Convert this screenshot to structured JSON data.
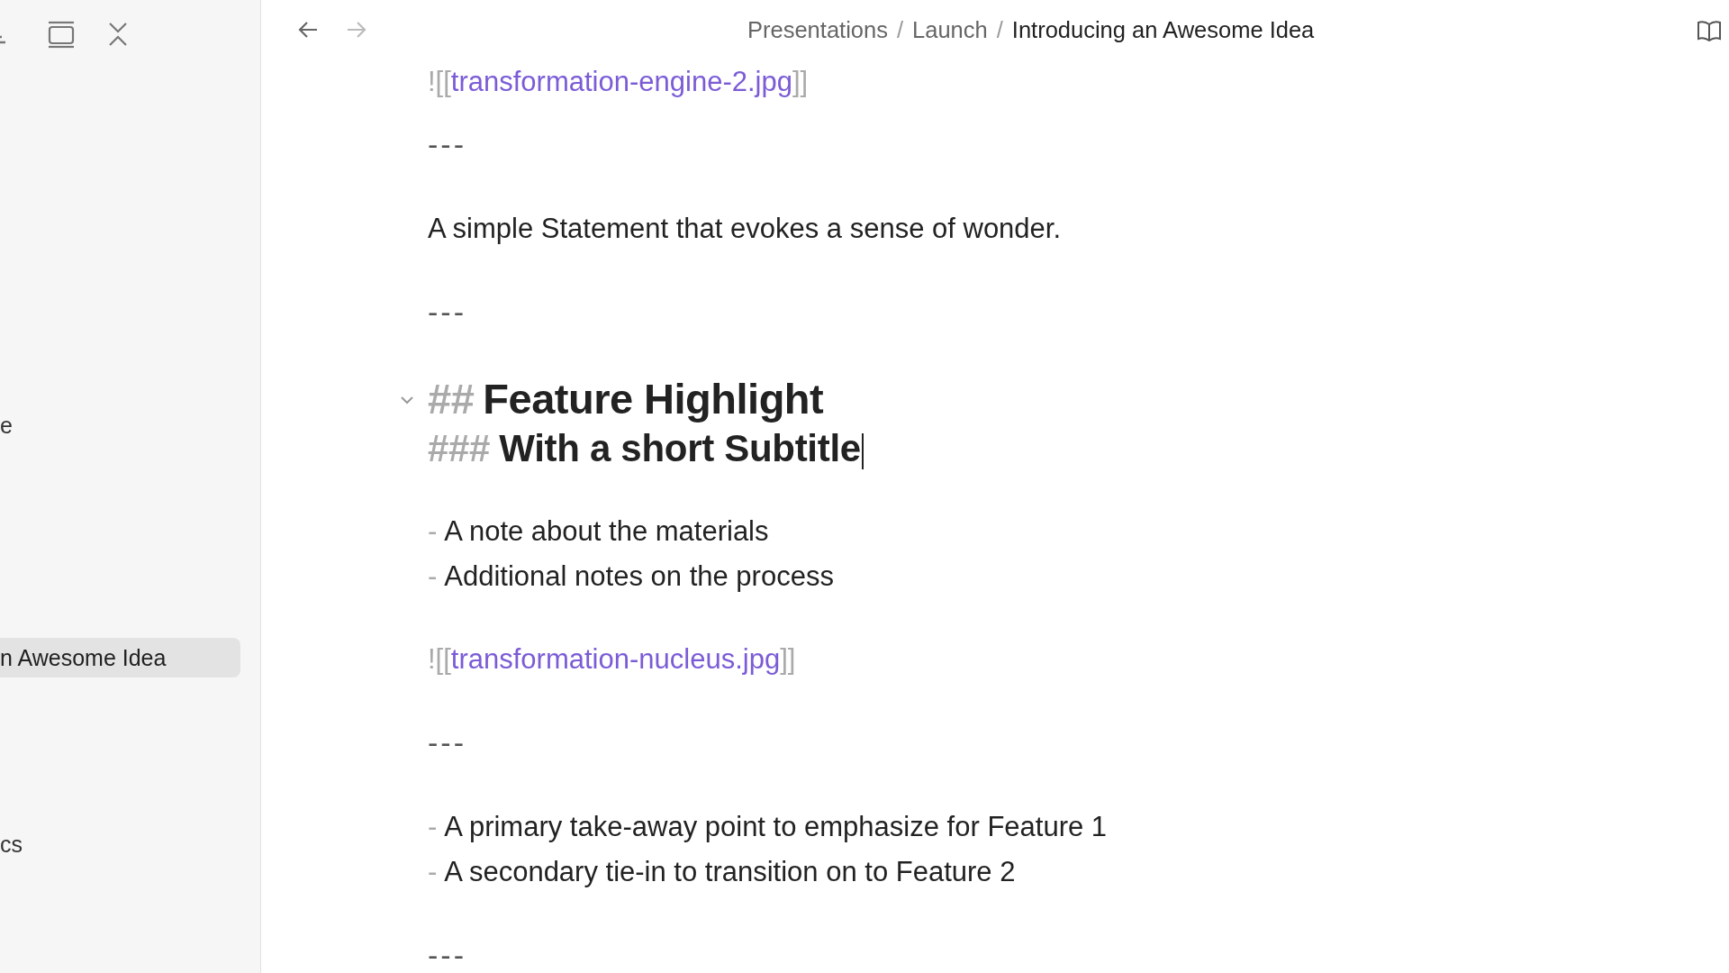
{
  "sidebar": {
    "items": [
      {
        "text": "e",
        "selected": false
      },
      {
        "text": "n Awesome Idea",
        "selected": true
      },
      {
        "text": "cs",
        "selected": false
      }
    ]
  },
  "navigation": {
    "back": {
      "disabled": false
    },
    "forward": {
      "disabled": true
    }
  },
  "breadcrumb": {
    "separator": "/",
    "segments": [
      {
        "text": "Presentations",
        "selected": false
      },
      {
        "text": "Launch",
        "selected": false
      },
      {
        "text": "Introducing an Awesome Idea",
        "selected": true
      }
    ]
  },
  "editor": {
    "lines": [
      {
        "kind": "embed",
        "open": "![[",
        "target": "transformation-engine-2.jpg",
        "close": "]]"
      },
      {
        "kind": "rule",
        "text": "---"
      },
      {
        "kind": "text",
        "text": "A simple Statement that evokes a sense of wonder."
      },
      {
        "kind": "rule",
        "text": "---"
      },
      {
        "kind": "h2",
        "marker": "##",
        "text": "Feature Highlight",
        "expanded": true
      },
      {
        "kind": "h3",
        "marker": "###",
        "text": "With a short Subtitle",
        "cursor": true
      },
      {
        "kind": "bullet",
        "marker": "-",
        "text": "A note about the materials"
      },
      {
        "kind": "bullet",
        "marker": "-",
        "text": "Additional notes on the process"
      },
      {
        "kind": "embed",
        "open": "![[",
        "target": "transformation-nucleus.jpg",
        "close": "]]"
      },
      {
        "kind": "rule",
        "text": "---"
      },
      {
        "kind": "bullet",
        "marker": "-",
        "text": "A primary take-away point to emphasize for Feature 1"
      },
      {
        "kind": "bullet",
        "marker": "-",
        "text": "A secondary tie-in to transition on to Feature 2"
      },
      {
        "kind": "rule",
        "text": "---"
      }
    ]
  }
}
